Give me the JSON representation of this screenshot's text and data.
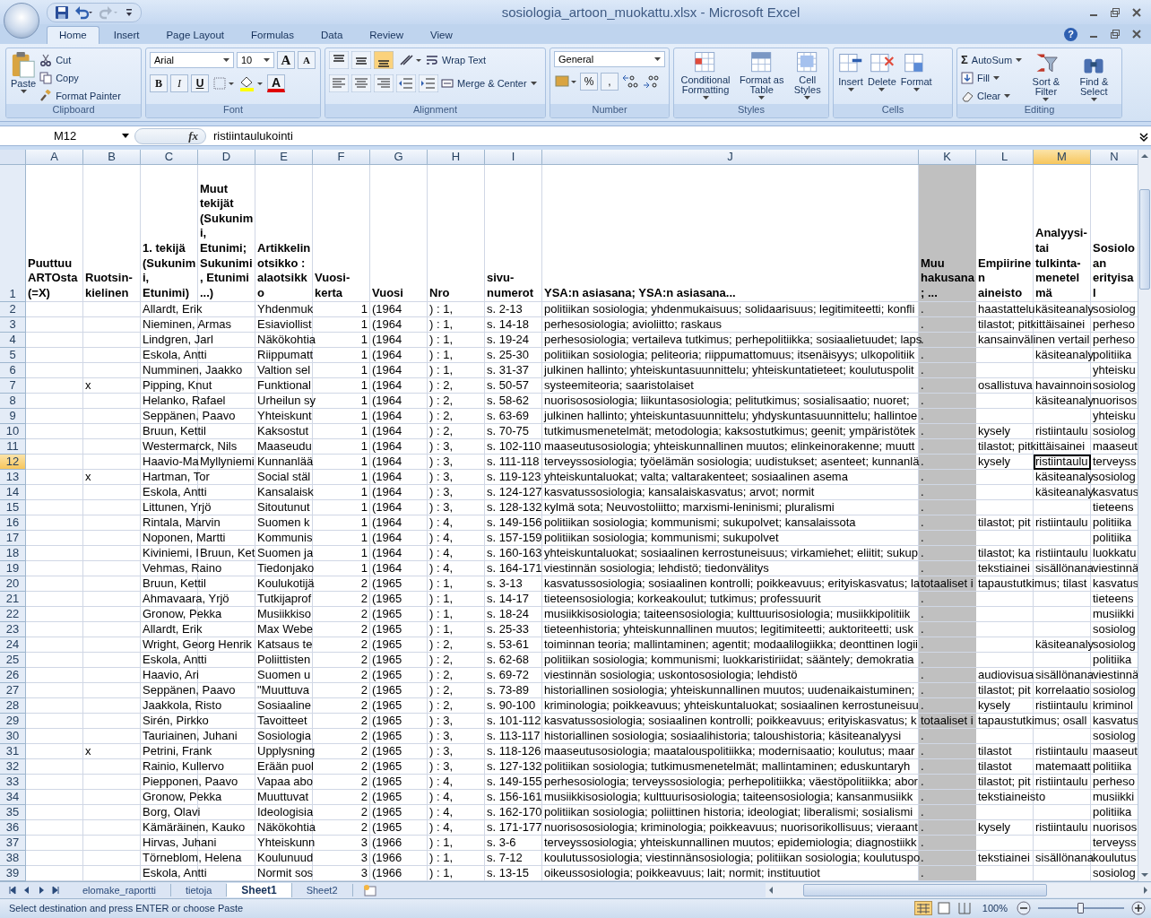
{
  "window": {
    "title": "sosiologia_artoon_muokattu.xlsx - Microsoft Excel",
    "help": "?"
  },
  "tabs": [
    {
      "label": "Home",
      "selected": true
    },
    {
      "label": "Insert",
      "selected": false
    },
    {
      "label": "Page Layout",
      "selected": false
    },
    {
      "label": "Formulas",
      "selected": false
    },
    {
      "label": "Data",
      "selected": false
    },
    {
      "label": "Review",
      "selected": false
    },
    {
      "label": "View",
      "selected": false
    }
  ],
  "clipboard": {
    "label": "Clipboard",
    "paste": "Paste",
    "items": [
      {
        "kind": "cut",
        "label": "Cut"
      },
      {
        "kind": "copy",
        "label": "Copy"
      },
      {
        "kind": "brush",
        "label": "Format Painter"
      }
    ]
  },
  "font": {
    "label": "Font",
    "family": "Arial",
    "size": "10",
    "grow": "A",
    "shrink": "A",
    "styles": [
      {
        "kind": "bold",
        "label": "B"
      },
      {
        "kind": "italic",
        "label": "I"
      },
      {
        "kind": "underline",
        "label": "U"
      }
    ],
    "color_letter": "A"
  },
  "alignment": {
    "label": "Alignment",
    "vertical": [
      {
        "selected": false
      },
      {
        "selected": false
      },
      {
        "selected": true
      }
    ],
    "wrap": "Wrap Text",
    "merge": "Merge & Center"
  },
  "number": {
    "label": "Number",
    "format": "General",
    "symbols": [
      "%",
      ","
    ]
  },
  "styles": {
    "label": "Styles",
    "buttons": [
      {
        "kind": "conditional",
        "label": "Conditional Formatting"
      },
      {
        "kind": "table",
        "label": "Format as Table"
      },
      {
        "kind": "cellstyle",
        "label": "Cell Styles"
      }
    ]
  },
  "cells": {
    "label": "Cells",
    "buttons": [
      {
        "kind": "insert",
        "label": "Insert"
      },
      {
        "kind": "delete",
        "label": "Delete"
      },
      {
        "kind": "format",
        "label": "Format"
      }
    ]
  },
  "editing": {
    "label": "Editing",
    "items": [
      {
        "kind": "sum",
        "symbol": "Σ",
        "label": "AutoSum"
      },
      {
        "kind": "fill",
        "label": "Fill"
      },
      {
        "kind": "clear",
        "label": "Clear"
      }
    ],
    "buttons": [
      {
        "kind": "sort",
        "label": "Sort & Filter"
      },
      {
        "kind": "find",
        "label": "Find & Select"
      }
    ]
  },
  "formula_bar": {
    "name_box": "M12",
    "fx": "fx",
    "value": "ristiintaulukointi"
  },
  "sheet": {
    "heading_row": "1",
    "columns": [
      {
        "letter": "A",
        "heading": "Puuttuu ARTOsta (=X)",
        "kind": "text",
        "selected": false,
        "shaded": false
      },
      {
        "letter": "B",
        "heading": "Ruotsin-kielinen",
        "kind": "text",
        "selected": false,
        "shaded": false
      },
      {
        "letter": "C",
        "heading": "1. tekijä (Sukunimi, Etunimi)",
        "kind": "text",
        "selected": false,
        "shaded": false
      },
      {
        "letter": "D",
        "heading": "Muut tekijät (Sukunimi, Etunimi; Sukunimi, Etunimi ...)",
        "kind": "text",
        "selected": false,
        "shaded": false
      },
      {
        "letter": "E",
        "heading": "Artikkelin otsikko : alaotsikko",
        "kind": "text",
        "selected": false,
        "shaded": false
      },
      {
        "letter": "F",
        "heading": "Vuosi-kerta",
        "kind": "number",
        "selected": false,
        "shaded": false
      },
      {
        "letter": "G",
        "heading": "Vuosi",
        "kind": "text",
        "selected": false,
        "shaded": false
      },
      {
        "letter": "H",
        "heading": "Nro",
        "kind": "text",
        "selected": false,
        "shaded": false
      },
      {
        "letter": "I",
        "heading": "sivu-numerot",
        "kind": "text",
        "selected": false,
        "shaded": false
      },
      {
        "letter": "J",
        "heading": "YSA:n asiasana; YSA:n asiasana...",
        "kind": "text",
        "selected": false,
        "shaded": false
      },
      {
        "letter": "K",
        "heading": "Muu hakusana; ...",
        "kind": "text",
        "selected": false,
        "shaded": true
      },
      {
        "letter": "L",
        "heading": "Empiirinen aineisto",
        "kind": "text",
        "selected": false,
        "shaded": false
      },
      {
        "letter": "M",
        "heading": "Analyysi-tai tulkinta-menetelmä",
        "kind": "text",
        "selected": true,
        "shaded": false
      },
      {
        "letter": "N",
        "heading": "Sosiolo an erityisal",
        "kind": "text",
        "selected": false,
        "shaded": false
      }
    ],
    "rows": [
      {
        "row": "2",
        "selected": false,
        "cells": [
          null,
          null,
          "Allardt, Erik",
          null,
          "Yhdenmuk",
          "1",
          "(1964",
          ") : 1,",
          "s. 2-13",
          "politiikan sosiologia; yhdenmukaisuus; solidaarisuus; legitimiteetti; konfli",
          ".",
          "haastattelu",
          "käsiteanaly",
          "sosiolog"
        ]
      },
      {
        "row": "3",
        "selected": false,
        "cells": [
          null,
          null,
          "Nieminen, Armas",
          null,
          "Esiaviollist",
          "1",
          "(1964",
          ") : 1,",
          "s. 14-18",
          "perhesosiologia; avioliitto; raskaus",
          ".",
          "tilastot; pitkittäisainei",
          null,
          "perheso"
        ]
      },
      {
        "row": "4",
        "selected": false,
        "cells": [
          null,
          null,
          "Lindgren, Jarl",
          null,
          "Näkökohtia",
          "1",
          "(1964",
          ") : 1,",
          "s. 19-24",
          "perhesosiologia; vertaileva tutkimus; perhepolitiikka; sosiaalietuudet; laps",
          ".",
          "kansainvälinen vertail",
          null,
          "perheso"
        ]
      },
      {
        "row": "5",
        "selected": false,
        "cells": [
          null,
          null,
          "Eskola, Antti",
          null,
          "Riippumatt",
          "1",
          "(1964",
          ") : 1,",
          "s. 25-30",
          "politiikan sosiologia; peliteoria; riippumattomuus; itsenäisyys; ulkopolitiik",
          ".",
          null,
          "käsiteanaly",
          "politiika"
        ]
      },
      {
        "row": "6",
        "selected": false,
        "cells": [
          null,
          null,
          "Numminen, Jaakko",
          null,
          "Valtion sel",
          "1",
          "(1964",
          ") : 1,",
          "s. 31-37",
          "julkinen hallinto; yhteiskuntasuunnittelu; yhteiskuntatieteet; koulutuspolit",
          ".",
          null,
          null,
          "yhteisku"
        ]
      },
      {
        "row": "7",
        "selected": false,
        "cells": [
          null,
          "x",
          "Pipping, Knut",
          null,
          "Funktional",
          "1",
          "(1964",
          ") : 2,",
          "s. 50-57",
          "systeemiteoria; saaristolaiset",
          ".",
          "osallistuva",
          "havainnoin",
          "sosiolog"
        ]
      },
      {
        "row": "8",
        "selected": false,
        "cells": [
          null,
          null,
          "Helanko, Rafael",
          null,
          "Urheilun sy",
          "1",
          "(1964",
          ") : 2,",
          "s. 58-62",
          "nuorisososiologia; liikuntasosiologia; pelitutkimus; sosialisaatio; nuoret;",
          ".",
          null,
          "käsiteanaly",
          "nuorisos"
        ]
      },
      {
        "row": "9",
        "selected": false,
        "cells": [
          null,
          null,
          "Seppänen, Paavo",
          null,
          "Yhteiskunt",
          "1",
          "(1964",
          ") : 2,",
          "s. 63-69",
          "julkinen hallinto; yhteiskuntasuunnittelu; yhdyskuntasuunnittelu; hallintoe",
          ".",
          null,
          null,
          "yhteisku"
        ]
      },
      {
        "row": "10",
        "selected": false,
        "cells": [
          null,
          null,
          "Bruun, Kettil",
          null,
          "Kaksostut",
          "1",
          "(1964",
          ") : 2,",
          "s. 70-75",
          "tutkimusmenetelmät; metodologia; kaksostutkimus; geenit; ympäristötek",
          ".",
          "kysely",
          "ristiintaulu",
          "sosiolog"
        ]
      },
      {
        "row": "11",
        "selected": false,
        "cells": [
          null,
          null,
          "Westermarck, Nils",
          null,
          "Maaseudu",
          "1",
          "(1964",
          ") : 3,",
          "s. 102-110",
          "maaseutusosiologia; yhteiskunnallinen muutos; elinkeinorakenne; muutt",
          ".",
          "tilastot; pitkittäisainei",
          null,
          "maaseut"
        ]
      },
      {
        "row": "12",
        "selected": true,
        "cells": [
          null,
          null,
          "Haavio-Ma",
          "Myllyniemi",
          "Kunnanlää",
          "1",
          "(1964",
          ") : 3,",
          "s. 111-118",
          "terveyssosiologia; työelämän sosiologia; uudistukset; asenteet; kunnanlä",
          ".",
          "kysely",
          "ristiintaulu",
          "terveyss"
        ]
      },
      {
        "row": "13",
        "selected": false,
        "cells": [
          null,
          "x",
          "Hartman, Tor",
          null,
          "Social stäl",
          "1",
          "(1964",
          ") : 3,",
          "s. 119-123",
          "yhteiskuntaluokat; valta; valtarakenteet; sosiaalinen asema",
          ".",
          null,
          "käsiteanaly",
          "sosiolog"
        ]
      },
      {
        "row": "14",
        "selected": false,
        "cells": [
          null,
          null,
          "Eskola, Antti",
          null,
          "Kansalaisk",
          "1",
          "(1964",
          ") : 3,",
          "s. 124-127",
          "kasvatussosiologia; kansalaiskasvatus; arvot; normit",
          ".",
          null,
          "käsiteanaly",
          "kasvatus"
        ]
      },
      {
        "row": "15",
        "selected": false,
        "cells": [
          null,
          null,
          "Littunen, Yrjö",
          null,
          "Sitoutunut",
          "1",
          "(1964",
          ") : 3,",
          "s. 128-132",
          "kylmä sota; Neuvostoliitto; marxismi-leninismi; pluralismi",
          ".",
          null,
          null,
          "tieteens"
        ]
      },
      {
        "row": "16",
        "selected": false,
        "cells": [
          null,
          null,
          "Rintala, Marvin",
          null,
          "Suomen k",
          "1",
          "(1964",
          ") : 4,",
          "s. 149-156",
          "politiikan sosiologia; kommunismi; sukupolvet; kansalaissota",
          ".",
          "tilastot; pit",
          "ristiintaulu",
          "politiika"
        ]
      },
      {
        "row": "17",
        "selected": false,
        "cells": [
          null,
          null,
          "Noponen, Martti",
          null,
          "Kommunis",
          "1",
          "(1964",
          ") : 4,",
          "s. 157-159",
          "politiikan sosiologia; kommunismi; sukupolvet",
          ".",
          null,
          null,
          "politiika"
        ]
      },
      {
        "row": "18",
        "selected": false,
        "cells": [
          null,
          null,
          "Kiviniemi, I",
          "Bruun, Ket",
          "Suomen ja",
          "1",
          "(1964",
          ") : 4,",
          "s. 160-163",
          "yhteiskuntaluokat; sosiaalinen kerrostuneisuus; virkamiehet; eliitit; sukup",
          ".",
          "tilastot; ka",
          "ristiintaulu",
          "luokkatu"
        ]
      },
      {
        "row": "19",
        "selected": false,
        "cells": [
          null,
          null,
          "Vehmas, Raino",
          null,
          "Tiedonjako",
          "1",
          "(1964",
          ") : 4,",
          "s. 164-171",
          "viestinnän sosiologia; lehdistö; tiedonvälitys",
          ".",
          "tekstiainei",
          "sisällönana",
          "viestinnä"
        ]
      },
      {
        "row": "20",
        "selected": false,
        "cells": [
          null,
          null,
          "Bruun, Kettil",
          null,
          "Koulukotijä",
          "2",
          "(1965",
          ") : 1,",
          "s. 3-13",
          "kasvatussosiologia; sosiaalinen kontrolli; poikkeavuus; erityiskasvatus; la",
          "totaaliset i",
          "tapaustutkimus; tilast",
          null,
          "kasvatus"
        ]
      },
      {
        "row": "21",
        "selected": false,
        "cells": [
          null,
          null,
          "Ahmavaara, Yrjö",
          null,
          "Tutkijaprof",
          "2",
          "(1965",
          ") : 1,",
          "s. 14-17",
          "tieteensosiologia; korkeakoulut; tutkimus; professuurit",
          ".",
          null,
          null,
          "tieteens"
        ]
      },
      {
        "row": "22",
        "selected": false,
        "cells": [
          null,
          null,
          "Gronow, Pekka",
          null,
          "Musiikkiso",
          "2",
          "(1965",
          ") : 1,",
          "s. 18-24",
          "musiikkisosiologia; taiteensosiologia; kulttuurisosiologia; musiikkipolitiik",
          ".",
          null,
          null,
          "musiikki"
        ]
      },
      {
        "row": "23",
        "selected": false,
        "cells": [
          null,
          null,
          "Allardt, Erik",
          null,
          "Max Webe",
          "2",
          "(1965",
          ") : 1,",
          "s. 25-33",
          "tieteenhistoria; yhteiskunnallinen muutos; legitimiteetti; auktoriteetti; usk",
          ".",
          null,
          null,
          "sosiolog"
        ]
      },
      {
        "row": "24",
        "selected": false,
        "cells": [
          null,
          null,
          "Wright, Georg Henrik",
          null,
          "Katsaus te",
          "2",
          "(1965",
          ") : 2,",
          "s. 53-61",
          "toiminnan teoria; mallintaminen; agentit; modaalilogiikka; deonttinen logii",
          ".",
          null,
          "käsiteanaly",
          "sosiolog"
        ]
      },
      {
        "row": "25",
        "selected": false,
        "cells": [
          null,
          null,
          "Eskola, Antti",
          null,
          "Poliittisten",
          "2",
          "(1965",
          ") : 2,",
          "s. 62-68",
          "politiikan sosiologia; kommunismi; luokkaristiriidat; sääntely; demokratia",
          ".",
          null,
          null,
          "politiika"
        ]
      },
      {
        "row": "26",
        "selected": false,
        "cells": [
          null,
          null,
          "Haavio, Ari",
          null,
          "Suomen u",
          "2",
          "(1965",
          ") : 2,",
          "s. 69-72",
          "viestinnän sosiologia; uskontososiologia; lehdistö",
          ".",
          "audiovisua",
          "sisällönana",
          "viestinnä"
        ]
      },
      {
        "row": "27",
        "selected": false,
        "cells": [
          null,
          null,
          "Seppänen, Paavo",
          null,
          "\"Muuttuva",
          "2",
          "(1965",
          ") : 2,",
          "s. 73-89",
          "historiallinen sosiologia; yhteiskunnallinen muutos; uudenaikaistuminen;",
          ".",
          "tilastot; pit",
          "korrelaatio",
          "sosiolog"
        ]
      },
      {
        "row": "28",
        "selected": false,
        "cells": [
          null,
          null,
          "Jaakkola, Risto",
          null,
          "Sosiaaline",
          "2",
          "(1965",
          ") : 2,",
          "s. 90-100",
          "kriminologia; poikkeavuus; yhteiskuntaluokat; sosiaalinen kerrostuneisuu",
          ".",
          "kysely",
          "ristiintaulu",
          "kriminol"
        ]
      },
      {
        "row": "29",
        "selected": false,
        "cells": [
          null,
          null,
          "Sirén, Pirkko",
          null,
          "Tavoitteet",
          "2",
          "(1965",
          ") : 3,",
          "s. 101-112",
          "kasvatussosiologia; sosiaalinen kontrolli; poikkeavuus; erityiskasvatus; k",
          "totaaliset i",
          "tapaustutkimus; osall",
          null,
          "kasvatus"
        ]
      },
      {
        "row": "30",
        "selected": false,
        "cells": [
          null,
          null,
          "Tauriainen, Juhani",
          null,
          "Sosiologia",
          "2",
          "(1965",
          ") : 3,",
          "s. 113-117",
          "historiallinen sosiologia; sosiaalihistoria; taloushistoria; käsiteanalyysi",
          ".",
          null,
          null,
          "sosiolog"
        ]
      },
      {
        "row": "31",
        "selected": false,
        "cells": [
          null,
          "x",
          "Petrini, Frank",
          null,
          "Upplysning",
          "2",
          "(1965",
          ") : 3,",
          "s. 118-126",
          "maaseutusosiologia; maatalouspolitiikka; modernisaatio; koulutus; maar",
          ".",
          "tilastot",
          "ristiintaulu",
          "maaseut"
        ]
      },
      {
        "row": "32",
        "selected": false,
        "cells": [
          null,
          null,
          "Rainio, Kullervo",
          null,
          "Erään puol",
          "2",
          "(1965",
          ") : 3,",
          "s. 127-132",
          "politiikan sosiologia; tutkimusmenetelmät; mallintaminen; eduskuntaryh",
          ".",
          "tilastot",
          "matemaatt",
          "politiika"
        ]
      },
      {
        "row": "33",
        "selected": false,
        "cells": [
          null,
          null,
          "Piepponen, Paavo",
          null,
          "Vapaa abo",
          "2",
          "(1965",
          ") : 4,",
          "s. 149-155",
          "perhesosiologia; terveyssosiologia; perhepolitiikka; väestöpolitiikka; abor",
          ".",
          "tilastot; pit",
          "ristiintaulu",
          "perheso"
        ]
      },
      {
        "row": "34",
        "selected": false,
        "cells": [
          null,
          null,
          "Gronow, Pekka",
          null,
          "Muuttuvat",
          "2",
          "(1965",
          ") : 4,",
          "s. 156-161",
          "musiikkisosiologia; kulttuurisosiologia; taiteensosiologia; kansanmusiikk",
          ".",
          "tekstiaineisto",
          null,
          "musiikki"
        ]
      },
      {
        "row": "35",
        "selected": false,
        "cells": [
          null,
          null,
          "Borg, Olavi",
          null,
          "Ideologisia",
          "2",
          "(1965",
          ") : 4,",
          "s. 162-170",
          "politiikan sosiologia; poliittinen historia; ideologiat; liberalismi; sosialismi",
          ".",
          null,
          null,
          "politiika"
        ]
      },
      {
        "row": "36",
        "selected": false,
        "cells": [
          null,
          null,
          "Kämäräinen, Kauko",
          null,
          "Näkökohtia",
          "2",
          "(1965",
          ") : 4,",
          "s. 171-177",
          "nuorisososiologia; kriminologia; poikkeavuus; nuorisorikollisuus; vieraant",
          ".",
          "kysely",
          "ristiintaulu",
          "nuorisos"
        ]
      },
      {
        "row": "37",
        "selected": false,
        "cells": [
          null,
          null,
          "Hirvas, Juhani",
          null,
          "Yhteiskunn",
          "3",
          "(1966",
          ") : 1,",
          "s. 3-6",
          "terveyssosiologia; yhteiskunnallinen muutos; epidemiologia; diagnostiikk",
          ".",
          null,
          null,
          "terveyss"
        ]
      },
      {
        "row": "38",
        "selected": false,
        "cells": [
          null,
          null,
          "Törneblom, Helena",
          null,
          "Koulunuud",
          "3",
          "(1966",
          ") : 1,",
          "s. 7-12",
          "koulutussosiologia; viestinnänsosiologia; politiikan sosiologia; koulutuspo",
          ".",
          "tekstiainei",
          "sisällönana",
          "koulutus"
        ]
      },
      {
        "row": "39",
        "selected": false,
        "cells": [
          null,
          null,
          "Eskola, Antti",
          null,
          "Normit sos",
          "3",
          "(1966",
          ") : 1,",
          "s. 13-15",
          "oikeussosiologia; poikkeavuus; lait; normit; instituutiot",
          ".",
          null,
          null,
          "sosiolog"
        ]
      }
    ]
  },
  "sheet_tabs": [
    {
      "label": "elomake_raportti",
      "selected": false
    },
    {
      "label": "tietoja",
      "selected": false
    },
    {
      "label": "Sheet1",
      "selected": true
    },
    {
      "label": "Sheet2",
      "selected": false
    }
  ],
  "status_bar": {
    "message": "Select destination and press ENTER or choose Paste",
    "zoom": "100%",
    "level": 0.5
  }
}
